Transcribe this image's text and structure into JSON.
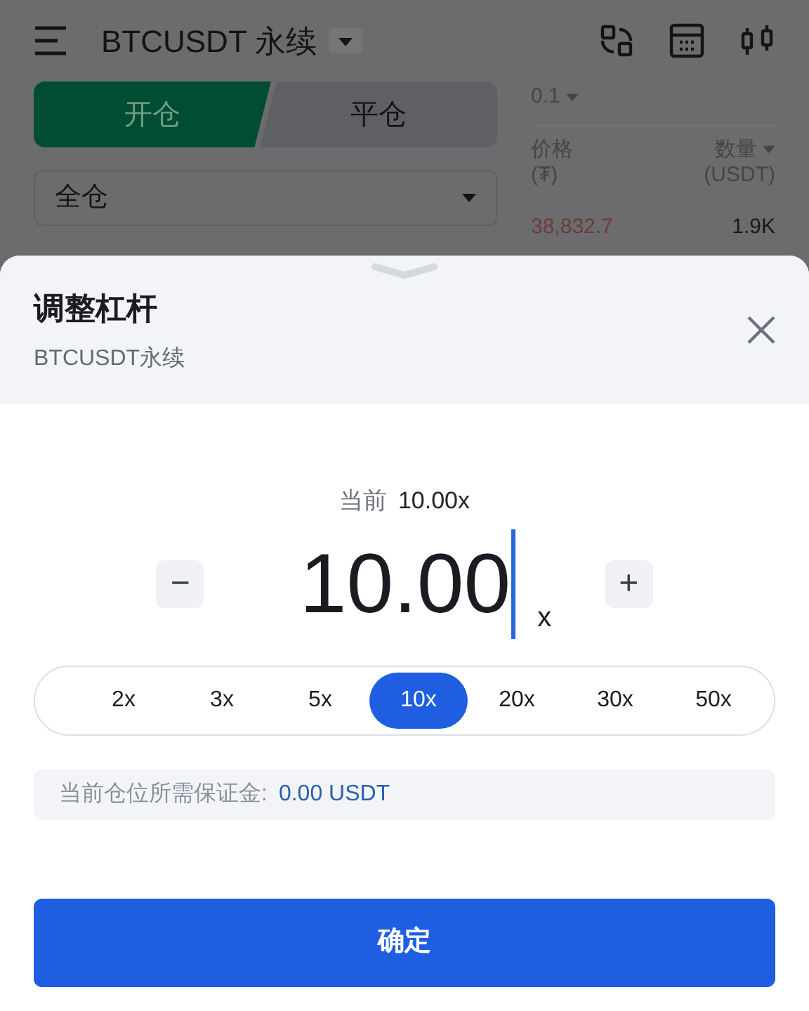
{
  "header": {
    "title": "BTCUSDT 永续"
  },
  "trade_tabs": [
    {
      "label": "开仓",
      "selected": true
    },
    {
      "label": "平仓",
      "selected": false
    }
  ],
  "margin_mode": {
    "value": "全仓"
  },
  "order_book": {
    "precision": "0.1",
    "columns": [
      {
        "label": "价格",
        "unit": "(₮)",
        "sortable": false
      },
      {
        "label": "数量",
        "unit": "(USDT)",
        "sortable": true
      }
    ],
    "rows": [
      {
        "price": "38,832.7",
        "amount": "1.9K"
      }
    ]
  },
  "sheet": {
    "title": "调整杠杆",
    "subtitle": "BTCUSDT永续",
    "current_label": "当前",
    "current_value": "10.00x",
    "input_value": "10.00",
    "unit": "x",
    "decrease": "−",
    "increase": "+",
    "presets": [
      {
        "label": "2x",
        "selected": false
      },
      {
        "label": "3x",
        "selected": false
      },
      {
        "label": "5x",
        "selected": false
      },
      {
        "label": "10x",
        "selected": true
      },
      {
        "label": "20x",
        "selected": false
      },
      {
        "label": "30x",
        "selected": false
      },
      {
        "label": "50x",
        "selected": false
      }
    ],
    "margin_label": "当前仓位所需保证金:",
    "margin_value": "0.00 USDT",
    "confirm": "确定"
  }
}
